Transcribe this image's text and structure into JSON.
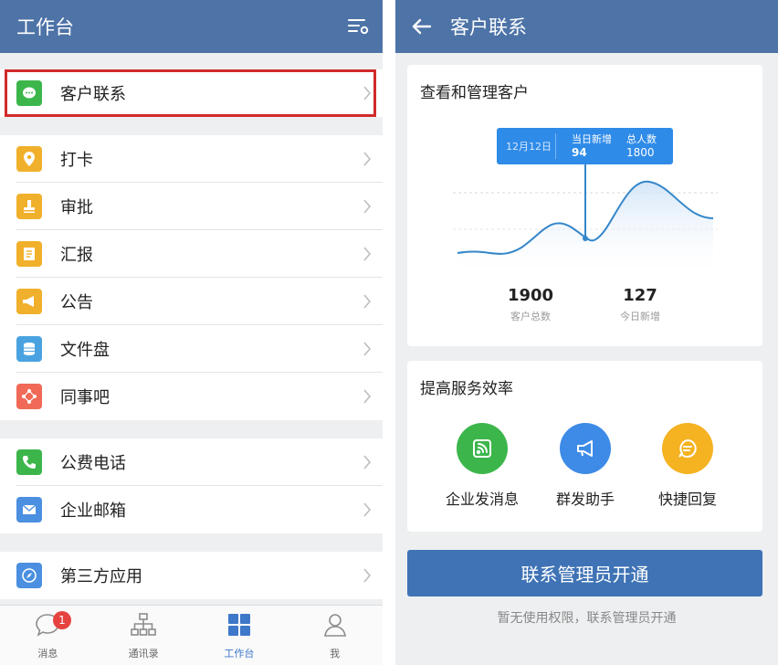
{
  "left": {
    "title": "工作台",
    "sections": [
      [
        {
          "label": "客户联系",
          "icon": "chat-bubble-icon",
          "color": "#3cb64b"
        }
      ],
      [
        {
          "label": "打卡",
          "icon": "location-pin-icon",
          "color": "#f1b02b"
        },
        {
          "label": "审批",
          "icon": "stamp-icon",
          "color": "#f1b02b"
        },
        {
          "label": "汇报",
          "icon": "report-icon",
          "color": "#f1b02b"
        },
        {
          "label": "公告",
          "icon": "megaphone-icon",
          "color": "#f1b02b"
        },
        {
          "label": "文件盘",
          "icon": "database-icon",
          "color": "#4aa3e0"
        },
        {
          "label": "同事吧",
          "icon": "network-icon",
          "color": "#f06a57"
        }
      ],
      [
        {
          "label": "公费电话",
          "icon": "phone-icon",
          "color": "#3cb64b"
        },
        {
          "label": "企业邮箱",
          "icon": "mail-icon",
          "color": "#4a8fe0"
        }
      ],
      [
        {
          "label": "第三方应用",
          "icon": "compass-icon",
          "color": "#4a8fe0"
        }
      ]
    ],
    "tabs": [
      {
        "label": "消息",
        "icon": "message-icon",
        "badge": "1"
      },
      {
        "label": "通讯录",
        "icon": "org-chart-icon"
      },
      {
        "label": "工作台",
        "icon": "grid-icon"
      },
      {
        "label": "我",
        "icon": "person-icon"
      }
    ],
    "active_tab": 2
  },
  "right": {
    "title": "客户联系",
    "card1": {
      "heading": "查看和管理客户",
      "tooltip": {
        "date": "12月12日",
        "new_label": "当日新增",
        "new_value": "94",
        "total_label": "总人数",
        "total_value": "1800"
      },
      "stats": [
        {
          "num": "1900",
          "cap": "客户总数"
        },
        {
          "num": "127",
          "cap": "今日新增"
        }
      ]
    },
    "card2": {
      "heading": "提高服务效率",
      "services": [
        {
          "label": "企业发消息",
          "icon": "broadcast-icon",
          "color": "#3cb64b"
        },
        {
          "label": "群发助手",
          "icon": "megaphone-icon",
          "color": "#3d8be6"
        },
        {
          "label": "快捷回复",
          "icon": "quick-reply-icon",
          "color": "#f5b221"
        }
      ]
    },
    "cta": "联系管理员开通",
    "note": "暂无使用权限，联系管理员开通"
  },
  "colors": {
    "header": "#4d73a7",
    "accent": "#3e78c9",
    "highlight": "#d12a2a"
  }
}
